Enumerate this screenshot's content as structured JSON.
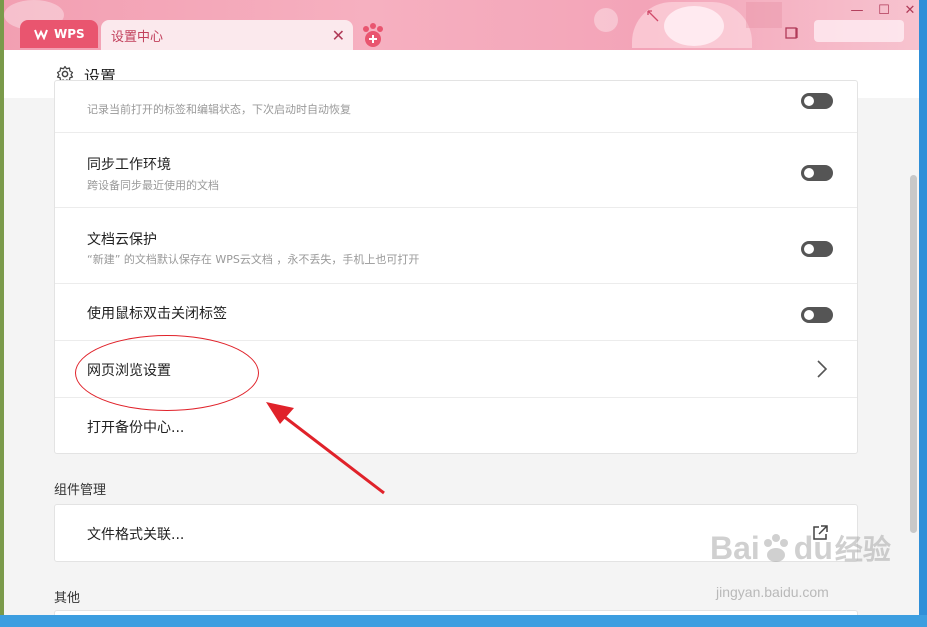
{
  "tabs": {
    "wps_label": "WPS",
    "settings_label": "设置中心"
  },
  "header": {
    "title": "设置"
  },
  "rows": [
    {
      "title": "",
      "desc": "记录当前打开的标签和编辑状态，下次启动时自动恢复",
      "control": "toggle"
    },
    {
      "title": "同步工作环境",
      "desc": "跨设备同步最近使用的文档",
      "control": "toggle"
    },
    {
      "title": "文档云保护",
      "desc": "“新建” 的文档默认保存在 WPS云文档 ，永不丢失，手机上也可打开",
      "control": "toggle"
    },
    {
      "title": "使用鼠标双击关闭标签",
      "desc": "",
      "control": "toggle"
    },
    {
      "title": "网页浏览设置",
      "desc": "",
      "control": "chevron"
    },
    {
      "title": "打开备份中心...",
      "desc": "",
      "control": "none"
    }
  ],
  "sections": {
    "components_label": "组件管理",
    "components_row": "文件格式关联...",
    "other_label": "其他"
  },
  "watermark": {
    "brand": "Bai",
    "brand_tail": "du",
    "suffix": "经验",
    "url": "jingyan.baidu.com"
  },
  "colors": {
    "titlebar": "#f3a4b8",
    "wps_tab": "#e9556f",
    "annotation": "#e0222a"
  }
}
